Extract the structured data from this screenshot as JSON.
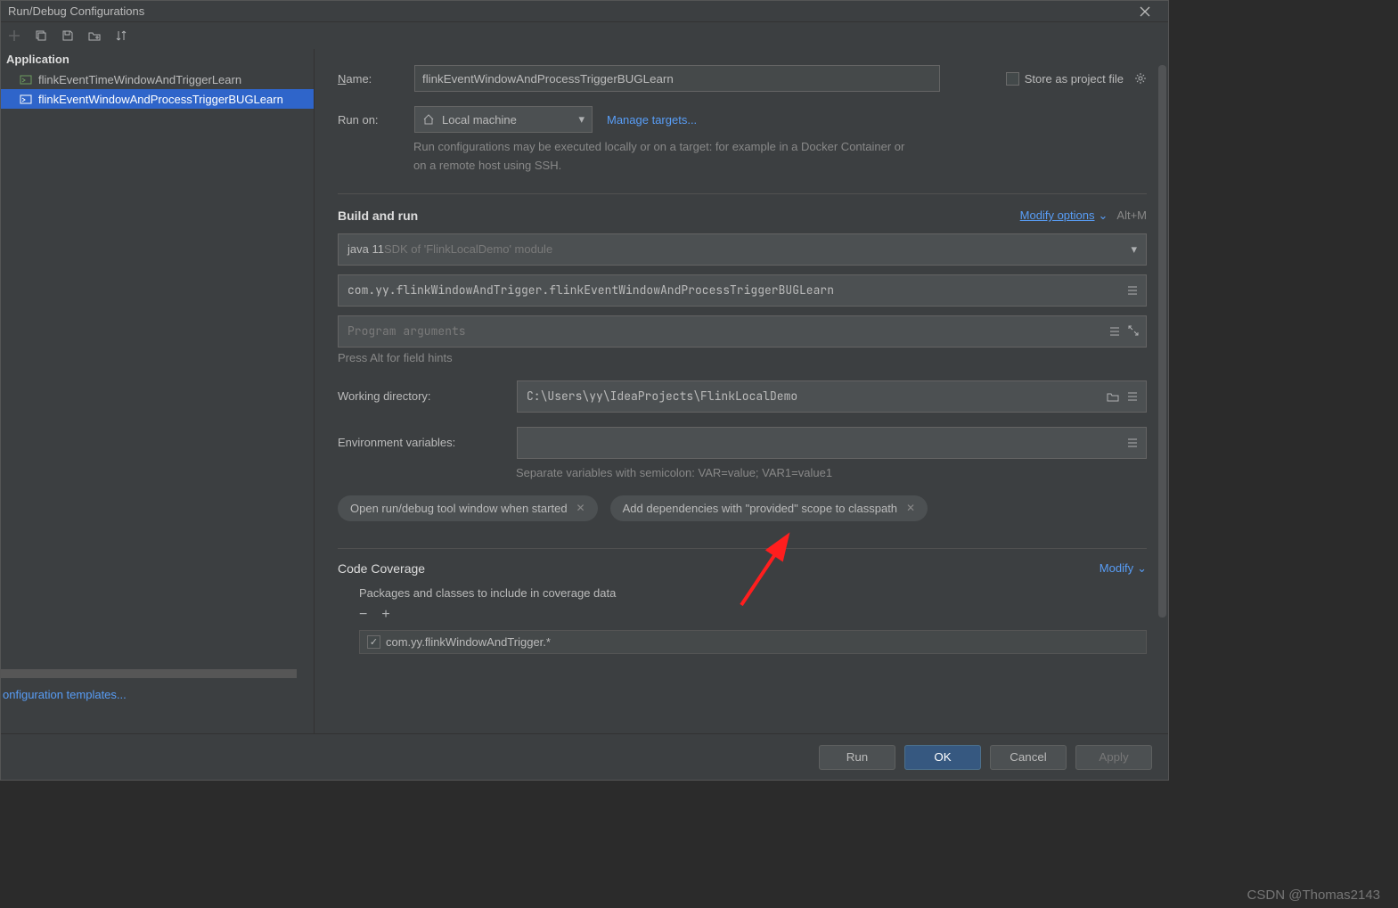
{
  "dialog": {
    "title": "Run/Debug Configurations"
  },
  "sidebar": {
    "heading": "Application",
    "items": [
      {
        "label": "flinkEventTimeWindowAndTriggerLearn"
      },
      {
        "label": "flinkEventWindowAndProcessTriggerBUGLearn"
      }
    ],
    "templates_link": "onfiguration templates..."
  },
  "form": {
    "name_label": "Name:",
    "name_value": "flinkEventWindowAndProcessTriggerBUGLearn",
    "store_label": "Store as project file",
    "run_on_label": "Run on:",
    "run_on_value": "Local machine",
    "manage_targets": "Manage targets...",
    "run_on_hint": "Run configurations may be executed locally or on a target: for example in a Docker Container or on a remote host using SSH.",
    "build_run_title": "Build and run",
    "modify_options": "Modify options",
    "modify_kbd": "Alt+M",
    "sdk_primary": "java 11",
    "sdk_secondary": " SDK of 'FlinkLocalDemo' module",
    "main_class": "com.yy.flinkWindowAndTrigger.flinkEventWindowAndProcessTriggerBUGLearn",
    "args_placeholder": "Program arguments",
    "alt_hint": "Press Alt for field hints",
    "workdir_label": "Working directory:",
    "workdir_value": "C:\\Users\\yy\\IdeaProjects\\FlinkLocalDemo",
    "envvars_label": "Environment variables:",
    "envvars_hint": "Separate variables with semicolon: VAR=value; VAR1=value1",
    "chips": [
      "Open run/debug tool window when started",
      "Add dependencies with \"provided\" scope to classpath"
    ],
    "coverage_title": "Code Coverage",
    "coverage_modify": "Modify",
    "packages_label": "Packages and classes to include in coverage data",
    "package_item": "com.yy.flinkWindowAndTrigger.*"
  },
  "buttons": {
    "run": "Run",
    "ok": "OK",
    "cancel": "Cancel",
    "apply": "Apply"
  },
  "watermark": "CSDN @Thomas2143"
}
